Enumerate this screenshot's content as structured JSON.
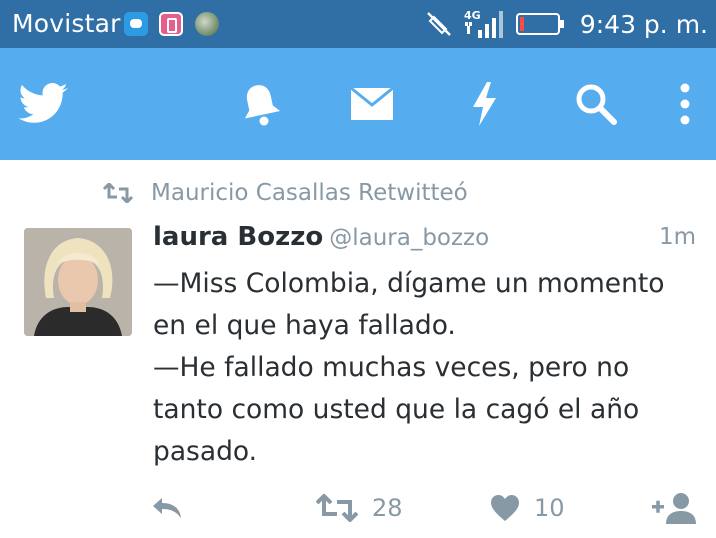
{
  "status_bar": {
    "carrier": "Movistar",
    "network": "4G",
    "time": "9:43 p. m."
  },
  "app_bar": {
    "icons": [
      "twitter-bird-icon",
      "bell-icon",
      "envelope-icon",
      "lightning-icon",
      "search-icon",
      "overflow-menu-icon"
    ],
    "color": "#55acee"
  },
  "tweet": {
    "retweeted_by": "Mauricio Casallas Retwitteó",
    "author_name": "laura Bozzo",
    "author_handle": "@laura_bozzo",
    "time": "1m",
    "text_lines": [
      "—Miss Colombia, dígame un momento",
      "en el que haya fallado.",
      "—He fallado muchas veces, pero no",
      "tanto como usted que la cagó el año",
      "pasado."
    ],
    "retweet_count": "28",
    "like_count": "10"
  }
}
